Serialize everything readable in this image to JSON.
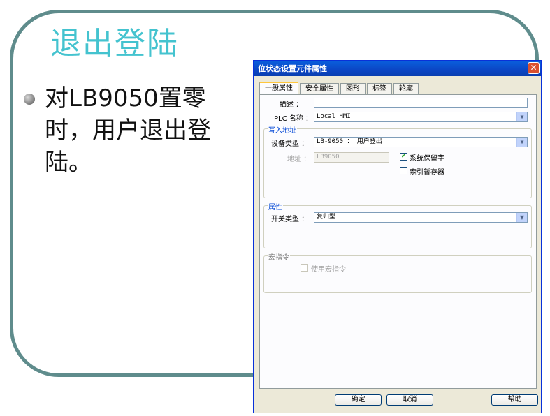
{
  "slide": {
    "title": "退出登陆",
    "bullet": "对LB9050置零时，用户退出登陆。"
  },
  "dialog": {
    "title": "位状态设置元件属性",
    "close_label": "✕",
    "tabs": [
      "一般属性",
      "安全属性",
      "图形",
      "标签",
      "轮廓"
    ],
    "description_label": "描述 ：",
    "description_value": "",
    "plc_label": "PLC 名称 ：",
    "plc_value": "Local HMI",
    "write_group": {
      "title": "写入地址",
      "device_type_label": "设备类型 ：",
      "device_type_value": "LB-9050 ： 用户登出",
      "address_label": "地址 ：",
      "address_value": "LB9050",
      "system_reserved_label": "系统保留字",
      "system_reserved_checked": true,
      "index_register_label": "索引暂存器",
      "index_register_checked": false
    },
    "attr_group": {
      "title": "属性",
      "switch_type_label": "开关类型 ：",
      "switch_type_value": "复归型"
    },
    "macro_group": {
      "title": "宏指令",
      "use_macro_label": "使用宏指令",
      "use_macro_checked": false
    },
    "buttons": {
      "ok": "确定",
      "cancel": "取消",
      "help": "帮助"
    }
  }
}
